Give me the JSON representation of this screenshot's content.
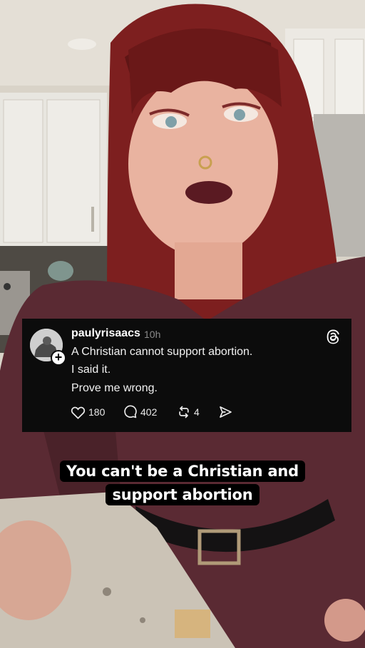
{
  "post": {
    "username": "paulyrisaacs",
    "time": "10h",
    "lines": [
      "A Christian cannot support abortion.",
      "I said it.",
      "Prove me wrong."
    ],
    "likes": "180",
    "replies": "402",
    "reposts": "4",
    "icons": {
      "platform": "threads-logo-icon",
      "like": "heart-icon",
      "reply": "speech-bubble-icon",
      "repost": "repost-icon",
      "share": "send-icon",
      "follow": "plus-icon"
    }
  },
  "captions": [
    "You can't be a Christian and",
    "support abortion"
  ],
  "colors": {
    "card_bg": "#0c0c0c",
    "hair": "#8b2020",
    "dress": "#5a2a33",
    "caption_bg": "#000000"
  }
}
